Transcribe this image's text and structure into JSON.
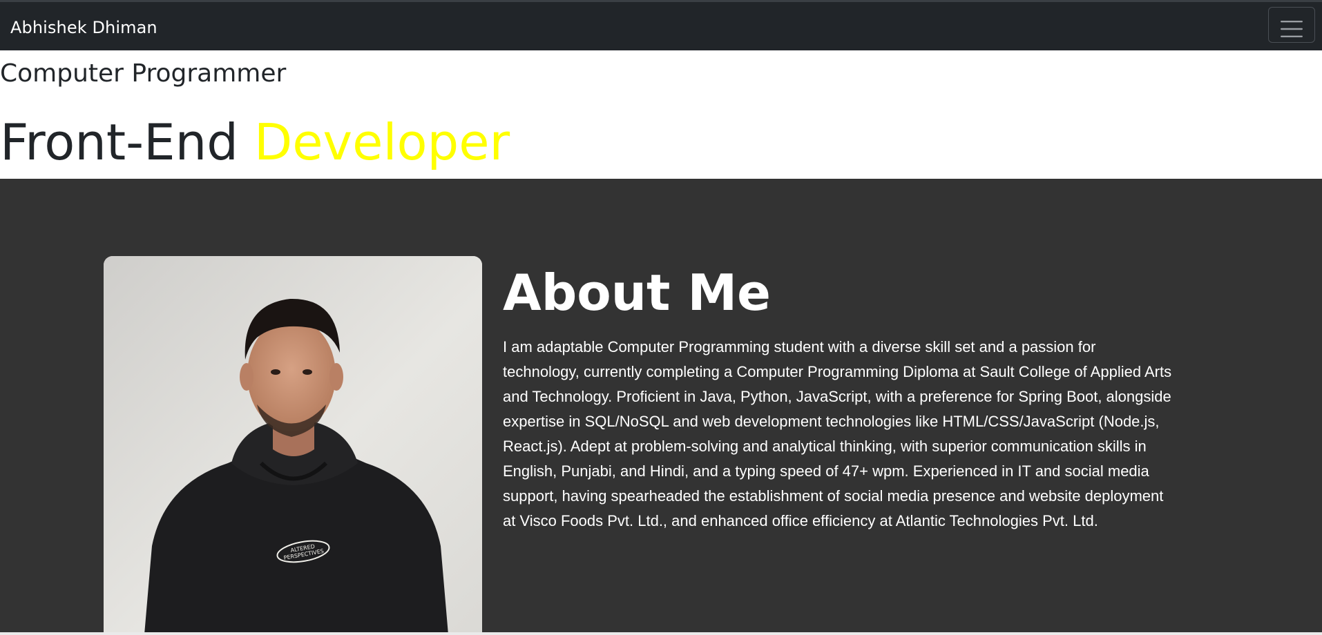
{
  "navbar": {
    "brand": "Abhishek Dhiman",
    "toggler_icon": "hamburger-menu-icon"
  },
  "hero": {
    "subtitle": "Computer Programmer",
    "headline_main": "Front-End ",
    "headline_accent": "Developer"
  },
  "about": {
    "title": "About Me",
    "photo_text": "ALTERED PERSPECTIVES",
    "paragraph": "I am adaptable Computer Programming student with a diverse skill set and a passion for technology, currently completing a Computer Programming Diploma at Sault College of Applied Arts and Technology. Proficient in Java, Python, JavaScript, with a preference for Spring Boot, alongside expertise in SQL/NoSQL and web development technologies like HTML/CSS/JavaScript (Node.js, React.js). Adept at problem-solving and analytical thinking, with superior communication skills in English, Punjabi, and Hindi, and a typing speed of 47+ wpm. Experienced in IT and social media support, having spearheaded the establishment of social media presence and website deployment at Visco Foods Pvt. Ltd., and enhanced office efficiency at Atlantic Technologies Pvt. Ltd."
  },
  "colors": {
    "navbar_bg": "#212529",
    "hero_bg": "#ffffff",
    "accent": "#ffff00",
    "about_bg": "#333333",
    "text_light": "#ffffff",
    "text_dark": "#212529"
  }
}
